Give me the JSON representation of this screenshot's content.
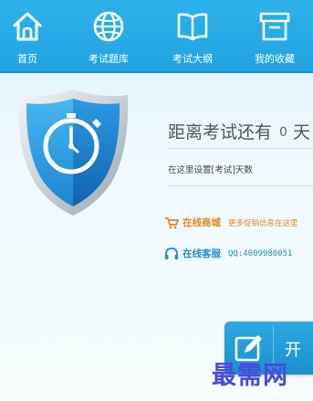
{
  "nav": {
    "items": [
      {
        "label": "首页",
        "icon": "home-icon"
      },
      {
        "label": "考试题库",
        "icon": "globe-icon"
      },
      {
        "label": "考试大纲",
        "icon": "book-icon"
      },
      {
        "label": "我的收藏",
        "icon": "archive-box-icon"
      }
    ]
  },
  "countdown": {
    "prefix": "距离考试还有",
    "days": "0",
    "suffix": "天"
  },
  "setting_link": "在这里设置[考试]天数",
  "store": {
    "label": "在线商城",
    "extra": "更多促销信息在这里"
  },
  "service": {
    "label": "在线客服",
    "extra": "QQ:4009980051"
  },
  "start_button": {
    "label": "开"
  },
  "watermark": "最需网",
  "colors": {
    "nav_bg": "#2eb2ea",
    "store_orange": "#e8871e",
    "service_blue": "#1b8ec7",
    "watermark": "#4a4ad8"
  }
}
